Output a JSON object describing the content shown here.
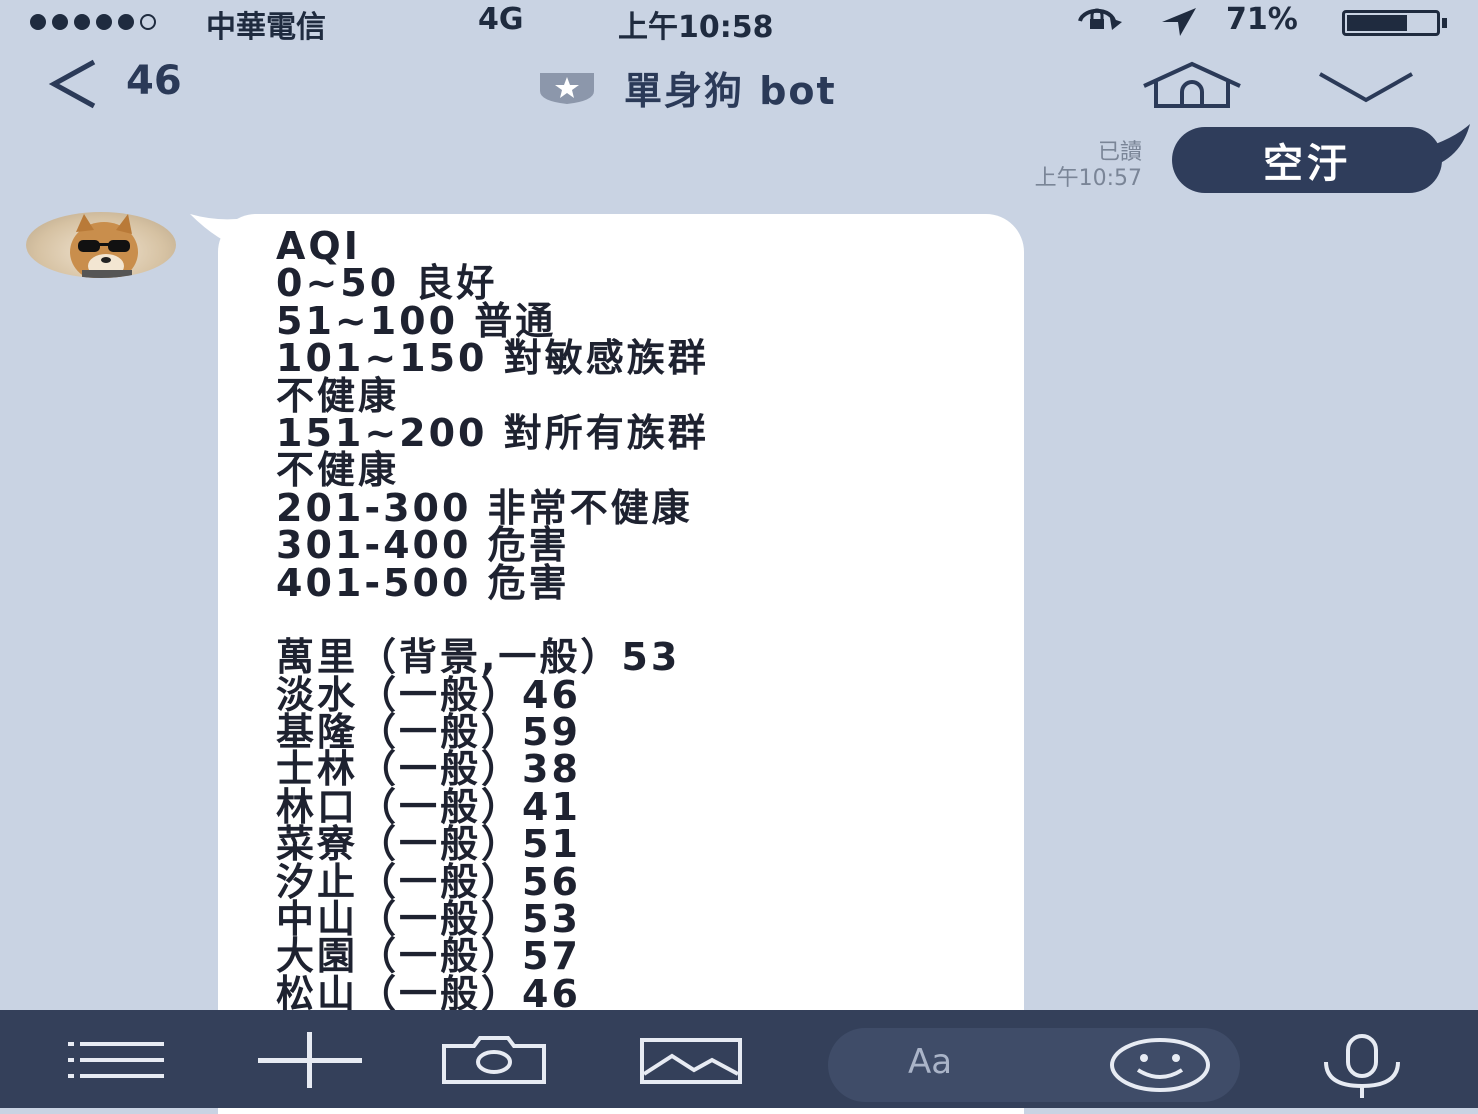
{
  "status_bar": {
    "carrier": "中華電信",
    "network": "4G",
    "time": "上午10:58",
    "battery": "71%",
    "battery_level": 0.71
  },
  "header": {
    "back_count": "46",
    "title": "單身狗 bot"
  },
  "sent_message": {
    "read_status": "已讀",
    "timestamp": "上午10:57",
    "text": "空汙"
  },
  "received_message": {
    "lines": [
      "AQI",
      "0~50 良好",
      "51~100 普通",
      "101~150 對敏感族群",
      "不健康",
      "151~200 對所有族群",
      "不健康",
      "201-300 非常不健康",
      "301-400 危害",
      "401-500 危害",
      "",
      "萬里（背景,一般）53",
      "淡水（一般）46",
      "基隆（一般）59",
      "士林（一般）38",
      "林口（一般）41",
      "菜寮（一般）51",
      "汐止（一般）56",
      "中山（一般）53",
      "大園（一般）57",
      "松山（一般）46"
    ]
  },
  "toolbar": {
    "input_placeholder": "Aa"
  },
  "colors": {
    "chat_background": "#c9d3e3",
    "sent_bubble": "#2f3d5b",
    "toolbar": "#34405a"
  }
}
